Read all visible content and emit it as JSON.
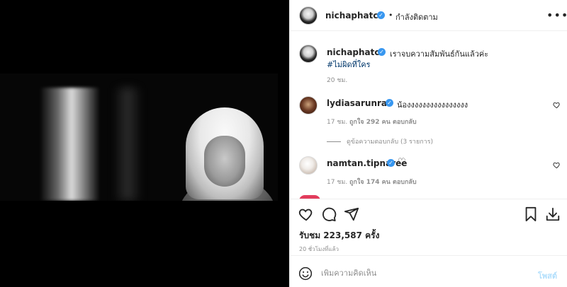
{
  "header": {
    "username": "nichaphatc",
    "separator": "•",
    "follow_status": "กำลังติดตาม",
    "more_icon": "more-horizontal-icon"
  },
  "caption": {
    "username": "nichaphatc",
    "text": "เราจบความสัมพันธ์กันแล้วค่ะ",
    "hashtag": "#ไม่ผิดที่ใคร",
    "time": "20 ชม."
  },
  "comments": [
    {
      "username": "lydiasarunrat",
      "text": "น้องงงงงงงงงงงงงงงง",
      "time": "17 ชม.",
      "likes": "ถูกใจ 292 คน",
      "reply": "ตอบกลับ",
      "view_replies": "ดูข้อความตอบกลับ (3 รายการ)"
    },
    {
      "username": "namtan.tipnaree",
      "text": "♡",
      "time": "17 ชม.",
      "likes": "ถูกใจ 174 คน",
      "reply": "ตอบกลับ"
    }
  ],
  "actions": {
    "views": "รับชม 223,587 ครั้ง",
    "posted_ago": "20 ชั่วโมงที่แล้ว"
  },
  "composer": {
    "placeholder": "เพิ่มความคิดเห็น",
    "post_label": "โพสต์"
  },
  "colors": {
    "verified": "#3897f0",
    "hashtag": "#00376b",
    "post_disabled": "#b2dffc",
    "muted": "#8e8e8e"
  }
}
